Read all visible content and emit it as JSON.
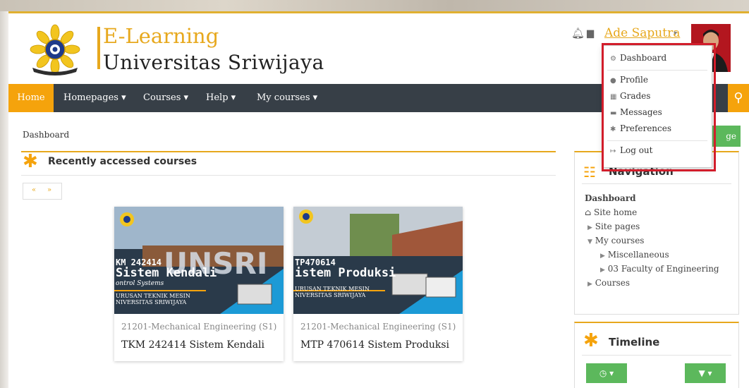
{
  "brand": {
    "line1": "E-Learning",
    "line2": "Universitas Sriwijaya"
  },
  "header": {
    "user_name": "Ade Saputra",
    "caret": "▾"
  },
  "navbar": {
    "items": [
      {
        "label": "Home"
      },
      {
        "label": "Homepages ▾"
      },
      {
        "label": "Courses ▾"
      },
      {
        "label": "Help ▾"
      },
      {
        "label": "My courses ▾"
      }
    ]
  },
  "breadcrumb": "Dashboard",
  "customise_button": "ge",
  "recent": {
    "title": "Recently accessed courses",
    "prev": "«",
    "next": "»",
    "courses": [
      {
        "category": "21201-Mechanical Engineering (S1)",
        "name": "TKM 242414 Sistem Kendali",
        "img_code": "KM 242414",
        "img_title": "Sistem Kendali",
        "img_sub": "ontrol Systems",
        "img_dept1": "URUSAN TEKNIK MESIN",
        "img_dept2": "NIVERSITAS SRIWIJAYA"
      },
      {
        "category": "21201-Mechanical Engineering (S1)",
        "name": "MTP 470614 Sistem Produksi",
        "img_code": "TP470614",
        "img_title": "istem Produksi",
        "img_sub": "",
        "img_dept1": "URUSAN TEKNIK MESIN",
        "img_dept2": "NIVERSITAS SRIWIJAYA"
      }
    ]
  },
  "navigation": {
    "title": "Navigation",
    "dashboard": "Dashboard",
    "site_home": "Site home",
    "site_pages": "Site pages",
    "my_courses": "My courses",
    "misc": "Miscellaneous",
    "faculty": "03 Faculty of Engineering",
    "courses": "Courses"
  },
  "timeline": {
    "title": "Timeline",
    "btn1": "◷ ▾",
    "btn2": "▼ ▾"
  },
  "user_menu": {
    "items": [
      "Dashboard",
      "Profile",
      "Grades",
      "Messages",
      "Preferences",
      "Log out"
    ]
  },
  "colors": {
    "accent": "#f5a30c",
    "navbar": "#373f47",
    "green": "#5cb85c",
    "highlight": "#d21d2b"
  }
}
